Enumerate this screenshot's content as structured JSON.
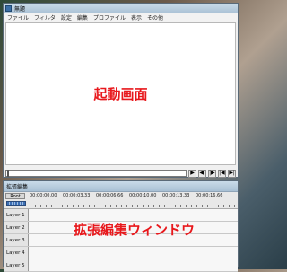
{
  "main_window": {
    "title": "無題",
    "menu": [
      "ファイル",
      "フィルタ",
      "設定",
      "編集",
      "プロファイル",
      "表示",
      "その他"
    ],
    "canvas_annotation": "起動画面",
    "controls": [
      "▶",
      "◀|",
      "|▶",
      "|◀",
      "▶|"
    ]
  },
  "ext_window": {
    "title": "拡張編集",
    "root_label": "Root",
    "timecodes": [
      "00:00:00.00",
      "00:00:03.33",
      "00:00:06.66",
      "00:00:10.00",
      "00:00:13.33",
      "00:00:16.66"
    ],
    "layers": [
      "Layer 1",
      "Layer 2",
      "Layer 3",
      "Layer 4",
      "Layer 5"
    ],
    "annotation": "拡張編集ウィンドウ"
  },
  "colors": {
    "annotation": "#e8181c",
    "titlebar": "#b8cde0",
    "scale": "#3b6fb5"
  }
}
